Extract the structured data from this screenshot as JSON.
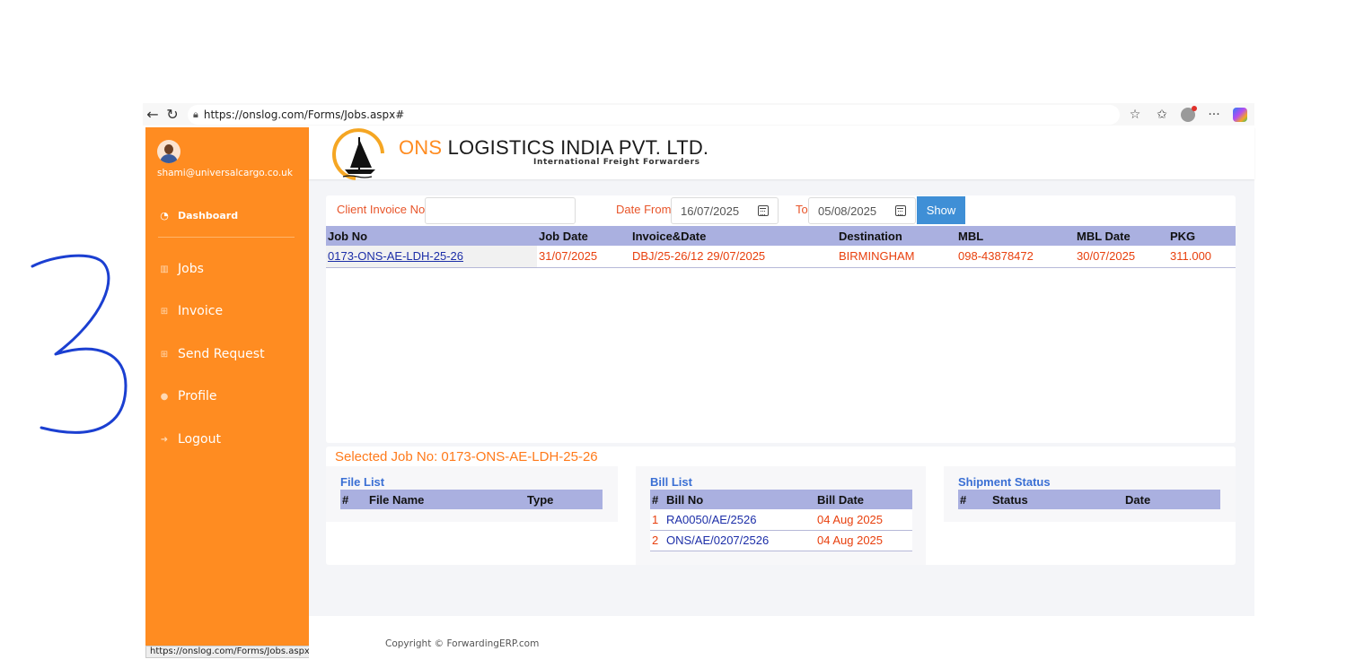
{
  "browser": {
    "url": "https://onslog.com/Forms/Jobs.aspx#",
    "icons": [
      "back-icon",
      "refresh-icon",
      "lock-icon",
      "star-icon",
      "favorites-icon",
      "profile-icon",
      "more-icon",
      "copilot-icon"
    ]
  },
  "sidebar": {
    "email": "shami@universalcargo.co.uk",
    "dashboard_label": "Dashboard",
    "items": [
      {
        "label": "Jobs",
        "icon": "chart-icon"
      },
      {
        "label": "Invoice",
        "icon": "table-icon"
      },
      {
        "label": "Send Request",
        "icon": "table-icon"
      },
      {
        "label": "Profile",
        "icon": "user-icon"
      },
      {
        "label": "Logout",
        "icon": "logout-icon"
      }
    ],
    "status_url": "https://onslog.com/Forms/Jobs.aspx#"
  },
  "header": {
    "company_prefix": "ONS",
    "company_rest": " LOGISTICS INDIA PVT. LTD.",
    "tagline": "International Freight Forwarders"
  },
  "filters": {
    "invoice_label": "Client Invoice No",
    "invoice_value": "",
    "date_from_label": "Date From",
    "date_from": "16/07/2025",
    "to_label": "To",
    "date_to": "05/08/2025",
    "show_label": "Show"
  },
  "jobs": {
    "columns": [
      "Job No",
      "Job Date",
      "Invoice&Date",
      "Destination",
      "MBL",
      "MBL Date",
      "PKG"
    ],
    "rows": [
      [
        "0173-ONS-AE-LDH-25-26",
        "31/07/2025",
        "DBJ/25-26/12 29/07/2025",
        "BIRMINGHAM",
        "098-43878472",
        "30/07/2025",
        "311.000"
      ]
    ]
  },
  "selected": {
    "title": "Selected Job No: 0173-ONS-AE-LDH-25-26",
    "file_list": {
      "title": "File List",
      "columns": [
        "#",
        "File Name",
        "Type"
      ]
    },
    "bill_list": {
      "title": "Bill List",
      "columns": [
        "#",
        "Bill No",
        "Bill Date"
      ],
      "rows": [
        [
          "1",
          "RA0050/AE/2526",
          "04 Aug 2025"
        ],
        [
          "2",
          "ONS/AE/0207/2526",
          "04 Aug 2025"
        ]
      ]
    },
    "shipment_status": {
      "title": "Shipment Status",
      "columns": [
        "#",
        "Status",
        "Date"
      ]
    }
  },
  "footer": {
    "copyright": "Copyright © ForwardingERP.com"
  },
  "colors": {
    "sidebar": "#ff8c21",
    "table_header": "#aab0e0",
    "accent_text": "#e8400e",
    "link": "#1c2ea8",
    "button": "#3f8fd6",
    "scribble": "#1b3fd1"
  }
}
